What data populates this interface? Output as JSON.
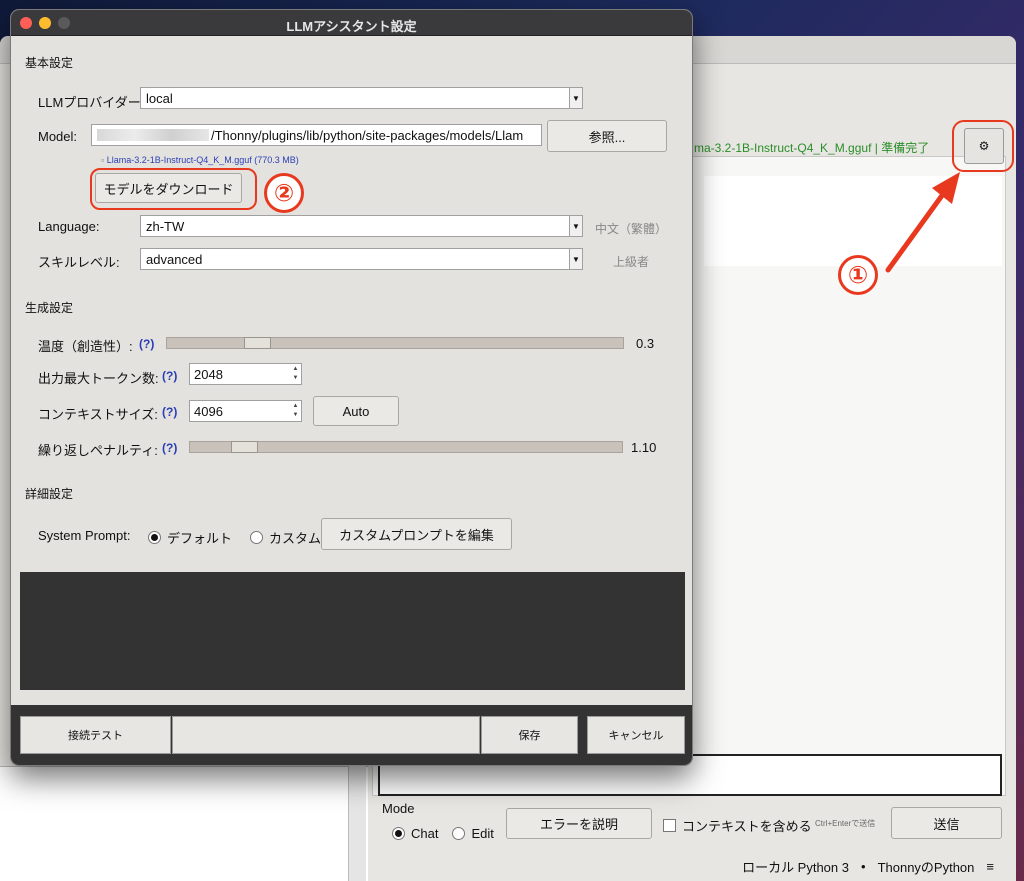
{
  "background": {
    "status_model": "ma-3.2-1B-Instruct-Q4_K_M.gguf | 準備完了",
    "gear_label": "⚙",
    "marker_1": "①",
    "mode_label": "Mode",
    "mode_chat": "Chat",
    "mode_edit": "Edit",
    "explain_error": "エラーを説明",
    "include_context": "コンテキストを含める",
    "shortcut_hint": "Ctrl+Enterで送信",
    "send": "送信",
    "status_python": "ローカル Python 3",
    "status_dot": "•",
    "status_interp": "ThonnyのPython",
    "status_menu": "≡"
  },
  "dialog": {
    "title": "LLMアシスタント設定",
    "basic_section": "基本設定",
    "provider_label": "LLMプロバイダー:",
    "provider_value": "local",
    "model_label": "Model:",
    "model_path": "/Thonny/plugins/lib/python/site-packages/models/Llam",
    "browse": "参照...",
    "model_file": "Llama-3.2-1B-Instruct-Q4_K_M.gguf (770.3 MB)",
    "download_model": "モデルをダウンロード",
    "marker_2": "②",
    "language_label": "Language:",
    "language_value": "zh-TW",
    "language_hint": "中文（繁體）",
    "skill_label": "スキルレベル:",
    "skill_value": "advanced",
    "skill_hint": "上級者",
    "gen_section": "生成設定",
    "temp_label": "温度（創造性）:",
    "help": "(?)",
    "temp_value": "0.3",
    "temp_fraction": 0.18,
    "max_tokens_label": "出力最大トークン数:",
    "max_tokens_value": "2048",
    "context_label": "コンテキストサイズ:",
    "context_value": "4096",
    "auto": "Auto",
    "penalty_label": "繰り返しペナルティ:",
    "penalty_value": "1.10",
    "penalty_fraction": 0.1,
    "adv_section": "詳細設定",
    "system_prompt_label": "System Prompt:",
    "default_opt": "デフォルト",
    "custom_opt": "カスタム",
    "edit_custom": "カスタムプロンプトを編集",
    "test_connection": "接続テスト",
    "save": "保存",
    "cancel": "キャンセル"
  },
  "colors": {
    "accent_red": "#e8391f",
    "status_green": "#2a8f2a",
    "help_blue": "#2a3fb5"
  }
}
